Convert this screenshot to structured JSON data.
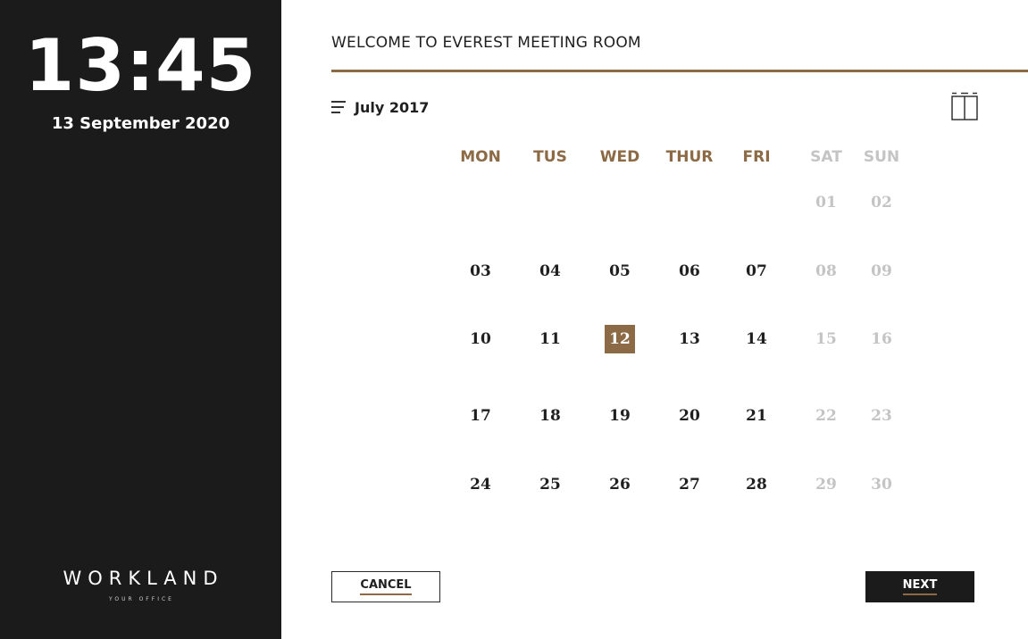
{
  "sidebar": {
    "time": "13:45",
    "date": "13 September 2020",
    "brand": "WORKLAND",
    "brand_tagline": "YOUR OFFICE"
  },
  "header": {
    "welcome": "WELCOME TO EVEREST MEETING ROOM"
  },
  "calendar": {
    "month": "July 2017",
    "menu_icon": "menu-icon",
    "room_icon": "door-icon",
    "accent_color": "#8b6a45",
    "weekdays": [
      "MON",
      "TUS",
      "WED",
      "THUR",
      "FRI",
      "SAT",
      "SUN"
    ],
    "selected_day": "12",
    "weeks": [
      [
        "",
        "",
        "",
        "",
        "",
        "01",
        "02"
      ],
      [
        "03",
        "04",
        "05",
        "06",
        "07",
        "08",
        "09"
      ],
      [
        "10",
        "11",
        "12",
        "13",
        "14",
        "15",
        "16"
      ],
      [
        "17",
        "18",
        "19",
        "20",
        "21",
        "22",
        "23"
      ],
      [
        "24",
        "25",
        "26",
        "27",
        "28",
        "29",
        "30"
      ]
    ]
  },
  "actions": {
    "cancel_label": "CANCEL",
    "next_label": "NEXT"
  }
}
